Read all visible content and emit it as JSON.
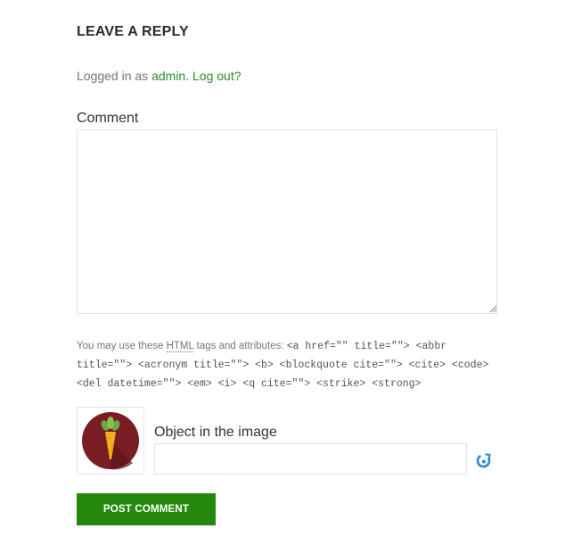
{
  "reply": {
    "title": "LEAVE A REPLY",
    "logged_prefix": "Logged in as ",
    "user_link": "admin.",
    "logout_link": "Log out?"
  },
  "comment": {
    "label": "Comment",
    "value": ""
  },
  "allowed_tags": {
    "prefix": "You may use these ",
    "abbr": "HTML",
    "middle": " tags and attributes: ",
    "code": "<a href=\"\" title=\"\"> <abbr title=\"\"> <acronym title=\"\"> <b> <blockquote cite=\"\"> <cite> <code> <del datetime=\"\"> <em> <i> <q cite=\"\"> <strike> <strong>"
  },
  "captcha": {
    "label": "Object in the image",
    "value": "",
    "image_icon": "carrot-icon",
    "refresh_icon": "refresh-icon"
  },
  "submit": {
    "label": "POST COMMENT"
  },
  "colors": {
    "accent": "#24890d",
    "link": "#2c8b2c",
    "captcha_circle": "#7a1c24",
    "refresh": "#2a8ad6"
  }
}
